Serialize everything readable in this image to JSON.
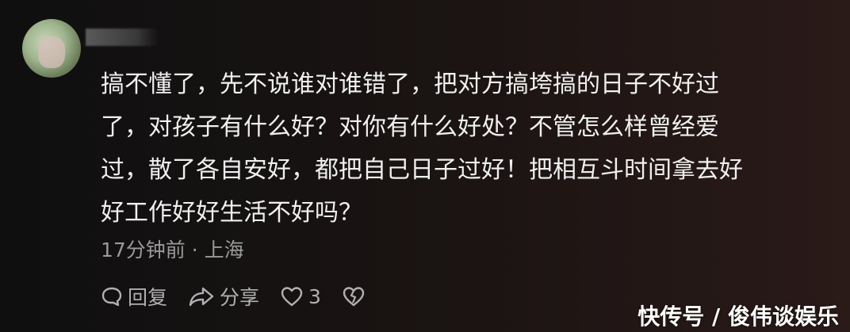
{
  "comment": {
    "lines": [
      "搞不懂了，先不说谁对谁错了，把对方搞垮搞的日子不好过",
      "了，对孩子有什么好？对你有什么好处？不管怎么样曾经爱",
      "过，散了各自安好，都把自己日子过好！把相互斗时间拿去好",
      "好工作好好生活不好吗？"
    ],
    "time_location": "17分钟前 · 上海"
  },
  "actions": {
    "reply_label": "回复",
    "share_label": "分享",
    "like_count": "3"
  },
  "watermark": "快传号 / 俊伟谈娱乐",
  "icons": [
    "reply-icon",
    "share-icon",
    "heart-icon",
    "dislike-heart-icon"
  ],
  "colors": {
    "text": "#f0f0f0",
    "meta": "#9a9a9a",
    "background": "#151313"
  }
}
